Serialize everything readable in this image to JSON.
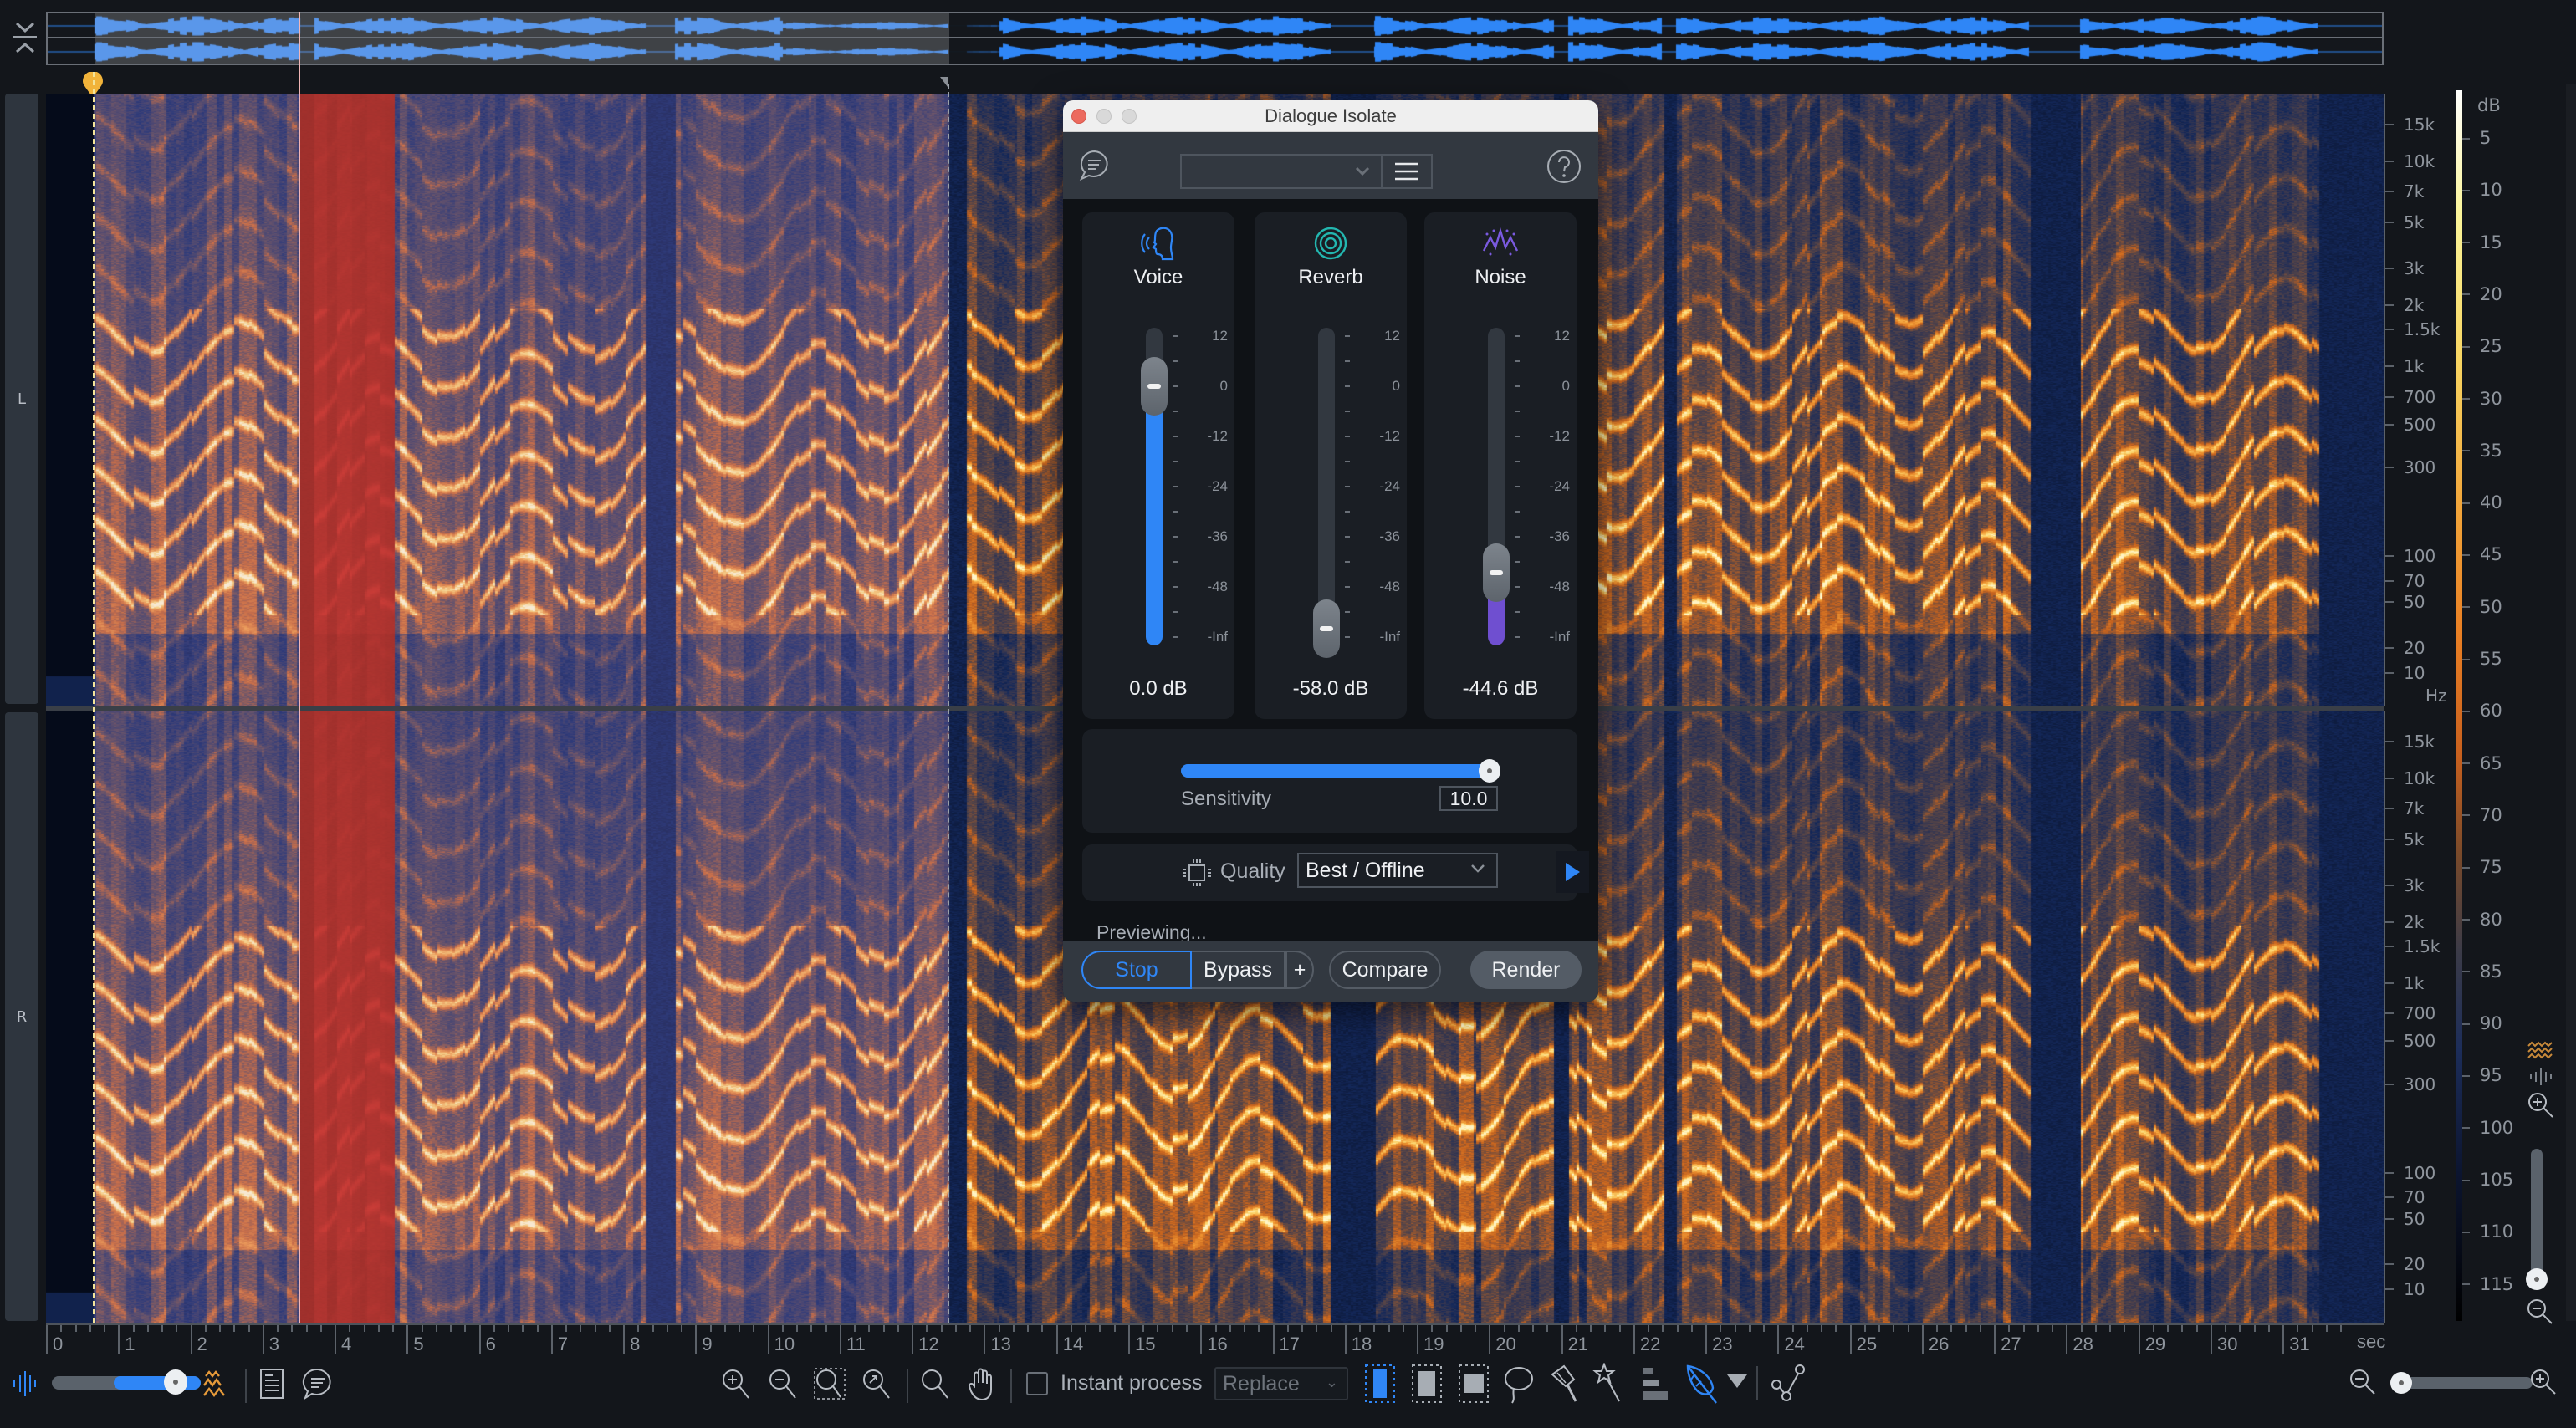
{
  "overview": {
    "channels": [
      "L",
      "R"
    ]
  },
  "channels": {
    "left_label": "L",
    "right_label": "R"
  },
  "frequency_scale": {
    "unit": "Hz",
    "ticks": [
      "15k",
      "10k",
      "7k",
      "5k",
      "3k",
      "2k",
      "1.5k",
      "1k",
      "700",
      "500",
      "300",
      "100",
      "70",
      "50",
      "20",
      "10"
    ]
  },
  "db_scale": {
    "unit": "dB",
    "ticks": [
      "5",
      "10",
      "15",
      "20",
      "25",
      "30",
      "35",
      "40",
      "45",
      "50",
      "55",
      "60",
      "65",
      "70",
      "75",
      "80",
      "85",
      "90",
      "95",
      "100",
      "105",
      "110",
      "115"
    ]
  },
  "ruler": {
    "unit": "sec",
    "ticks": [
      "0",
      "1",
      "2",
      "3",
      "4",
      "5",
      "6",
      "7",
      "8",
      "9",
      "10",
      "11",
      "12",
      "13",
      "14",
      "15",
      "16",
      "17",
      "18",
      "19",
      "20",
      "21",
      "22",
      "23",
      "24",
      "25",
      "26",
      "27",
      "28",
      "29",
      "30",
      "31"
    ]
  },
  "selection": {
    "start_sec": 0.65,
    "end_sec": 12.5,
    "playhead_sec": 3.5,
    "highlight_start_sec": 3.5,
    "highlight_end_sec": 4.8
  },
  "toolbar": {
    "instant_process_label": "Instant process",
    "instant_process_checked": false,
    "mode_select_value": "Replace",
    "spectrogram_waveform_blend": 0.72,
    "horizontal_zoom": 0.05
  },
  "vertical_zoom": 0.05,
  "dialog": {
    "title": "Dialogue Isolate",
    "preset_value": "",
    "faders": [
      {
        "name": "Voice",
        "icon": "voice-icon",
        "value_label": "0.0 dB",
        "value_db": 0.0,
        "color": "#2f86f6"
      },
      {
        "name": "Reverb",
        "icon": "reverb-icon",
        "value_label": "-58.0 dB",
        "value_db": -58.0,
        "color": "#2f86f6"
      },
      {
        "name": "Noise",
        "icon": "noise-icon",
        "value_label": "-44.6 dB",
        "value_db": -44.6,
        "color": "#6f4fd0"
      }
    ],
    "fader_scale": [
      "12",
      "0",
      "-12",
      "-24",
      "-36",
      "-48",
      "-Inf"
    ],
    "sensitivity": {
      "label": "Sensitivity",
      "value": "10.0",
      "fraction": 1.0
    },
    "quality": {
      "label": "Quality",
      "value": "Best / Offline"
    },
    "status": "Previewing...",
    "buttons": {
      "stop": "Stop",
      "bypass": "Bypass",
      "bypass_plus": "+",
      "compare": "Compare",
      "render": "Render"
    }
  },
  "colors": {
    "accent": "#2f86f6",
    "noise_accent": "#6f4fd0",
    "reverb_icon": "#23b7b0",
    "marker": "#f1b33a",
    "selection_highlight": "#c0392b"
  }
}
